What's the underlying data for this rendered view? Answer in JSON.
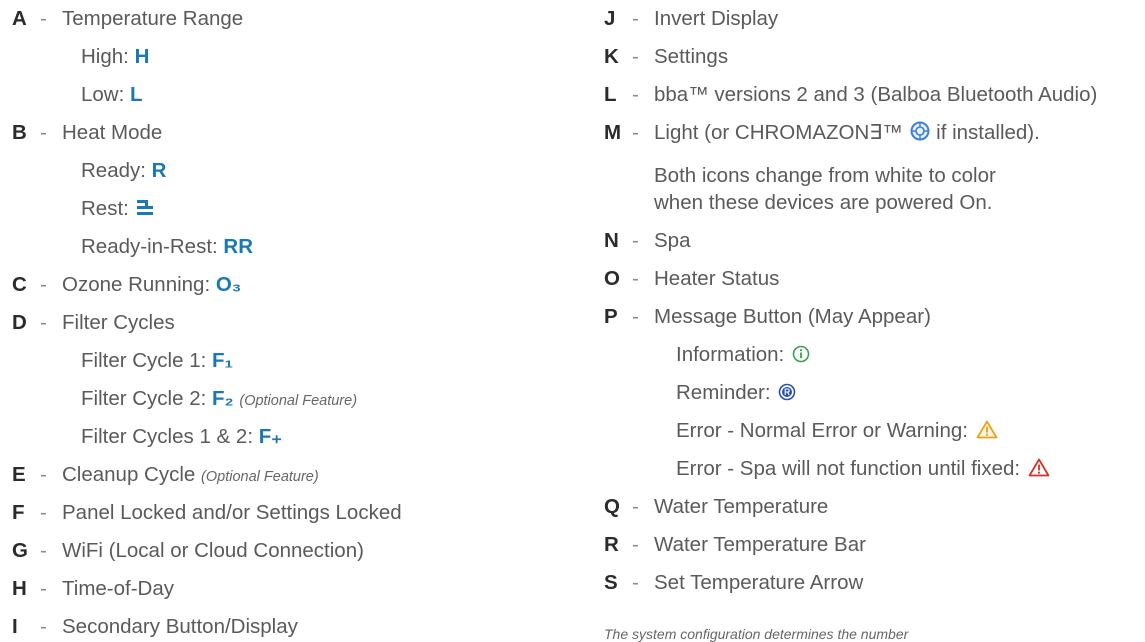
{
  "left_column": [
    {
      "letter": "A",
      "text": "Temperature Range"
    },
    {
      "label": "High:",
      "value": "H"
    },
    {
      "label": "Low:",
      "value": "L"
    },
    {
      "letter": "B",
      "text": "Heat Mode"
    },
    {
      "label": "Ready:",
      "value": "R"
    },
    {
      "label": "Rest:",
      "icon": "rest-mode-icon"
    },
    {
      "label": "Ready-in-Rest:",
      "value": "RR"
    },
    {
      "letter": "C",
      "text": "Ozone Running:",
      "value": "O₃"
    },
    {
      "letter": "D",
      "text": "Filter Cycles"
    },
    {
      "label": "Filter Cycle 1:",
      "value": "F₁"
    },
    {
      "label": "Filter Cycle 2:",
      "value": "F₂",
      "note": "(Optional Feature)"
    },
    {
      "label": "Filter Cycles 1 & 2:",
      "value": "F₊"
    },
    {
      "letter": "E",
      "text": "Cleanup Cycle",
      "note": "(Optional Feature)"
    },
    {
      "letter": "F",
      "text": "Panel Locked and/or Settings Locked"
    },
    {
      "letter": "G",
      "text": "WiFi (Local or Cloud Connection)"
    },
    {
      "letter": "H",
      "text": "Time-of-Day"
    },
    {
      "letter": "I",
      "text": "Secondary Button/Display"
    }
  ],
  "right_column": [
    {
      "letter": "J",
      "text": "Invert Display"
    },
    {
      "letter": "K",
      "text": "Settings"
    },
    {
      "letter": "L",
      "text": "bba™ versions 2 and 3 (Balboa Bluetooth Audio)"
    },
    {
      "letter": "M",
      "text": "Light (or CHROMAZON∃™",
      "text_after": "if installed).",
      "icon": "chromazone-icon"
    },
    {
      "cont": "Both icons change from white to color"
    },
    {
      "cont": "when these devices are powered On."
    },
    {
      "letter": "N",
      "text": "Spa"
    },
    {
      "letter": "O",
      "text": "Heater Status"
    },
    {
      "letter": "P",
      "text": "Message Button (May Appear)"
    },
    {
      "label": "Information:",
      "icon": "info-icon",
      "color": "#3aa04a"
    },
    {
      "label": "Reminder:",
      "icon": "reminder-icon",
      "color": "#2a4fa8"
    },
    {
      "label": "Error - Normal Error or Warning:",
      "icon": "warning-icon",
      "color": "#e8a21a"
    },
    {
      "label": "Error - Spa will not function until fixed:",
      "icon": "error-icon",
      "color": "#d9302a"
    },
    {
      "letter": "Q",
      "text": "Water Temperature"
    },
    {
      "letter": "R",
      "text": "Water Temperature Bar"
    },
    {
      "letter": "S",
      "text": "Set Temperature Arrow"
    }
  ],
  "footer_note": "The system configuration determines the number",
  "dash": "-",
  "accent_color": "#1a78b5"
}
